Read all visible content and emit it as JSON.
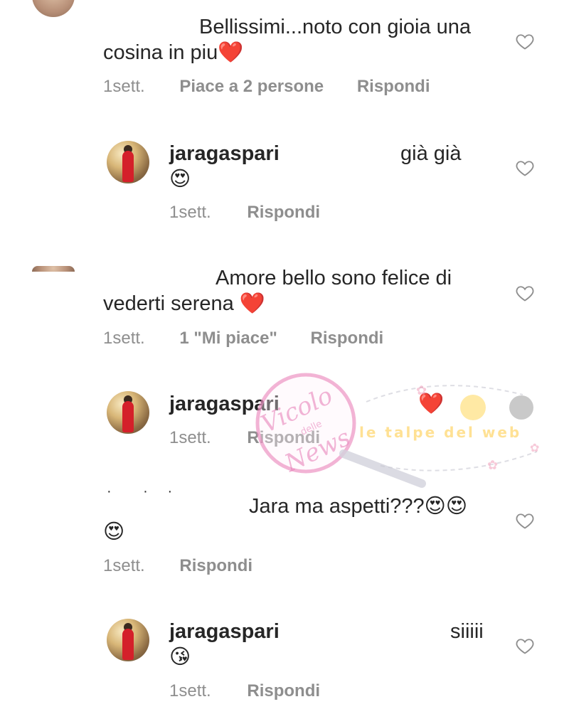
{
  "comments": [
    {
      "line1": "Bellissimi...noto con gioia una",
      "line2": "cosina in piu",
      "line2_emoji": "❤️",
      "time": "1sett.",
      "likes": "Piace a 2 persone",
      "reply": "Rispondi"
    },
    {
      "username": "jaragaspari",
      "text": "già già",
      "emoji": "😍",
      "time": "1sett.",
      "reply": "Rispondi"
    },
    {
      "line1": "Amore bello sono felice di",
      "line2": "vederti serena",
      "line2_emoji": "❤️",
      "time": "1sett.",
      "likes": "1 \"Mi piace\"",
      "reply": "Rispondi"
    },
    {
      "username": "jaragaspari",
      "emoji": "❤️",
      "time": "1sett.",
      "reply": "Rispondi"
    },
    {
      "line1": "Jara ma aspetti???",
      "line1_emoji": "😍😍",
      "line2_emoji": "😍",
      "time": "1sett.",
      "reply": "Rispondi"
    },
    {
      "username": "jaragaspari",
      "text": "siiiii",
      "emoji": "😘",
      "time": "1sett.",
      "reply": "Rispondi"
    }
  ],
  "watermarks": {
    "vicolo": "Vicolo",
    "delle": "delle",
    "news": "News",
    "talpe": "le talpe del web"
  },
  "icons": {
    "like": "heart-outline-icon"
  }
}
